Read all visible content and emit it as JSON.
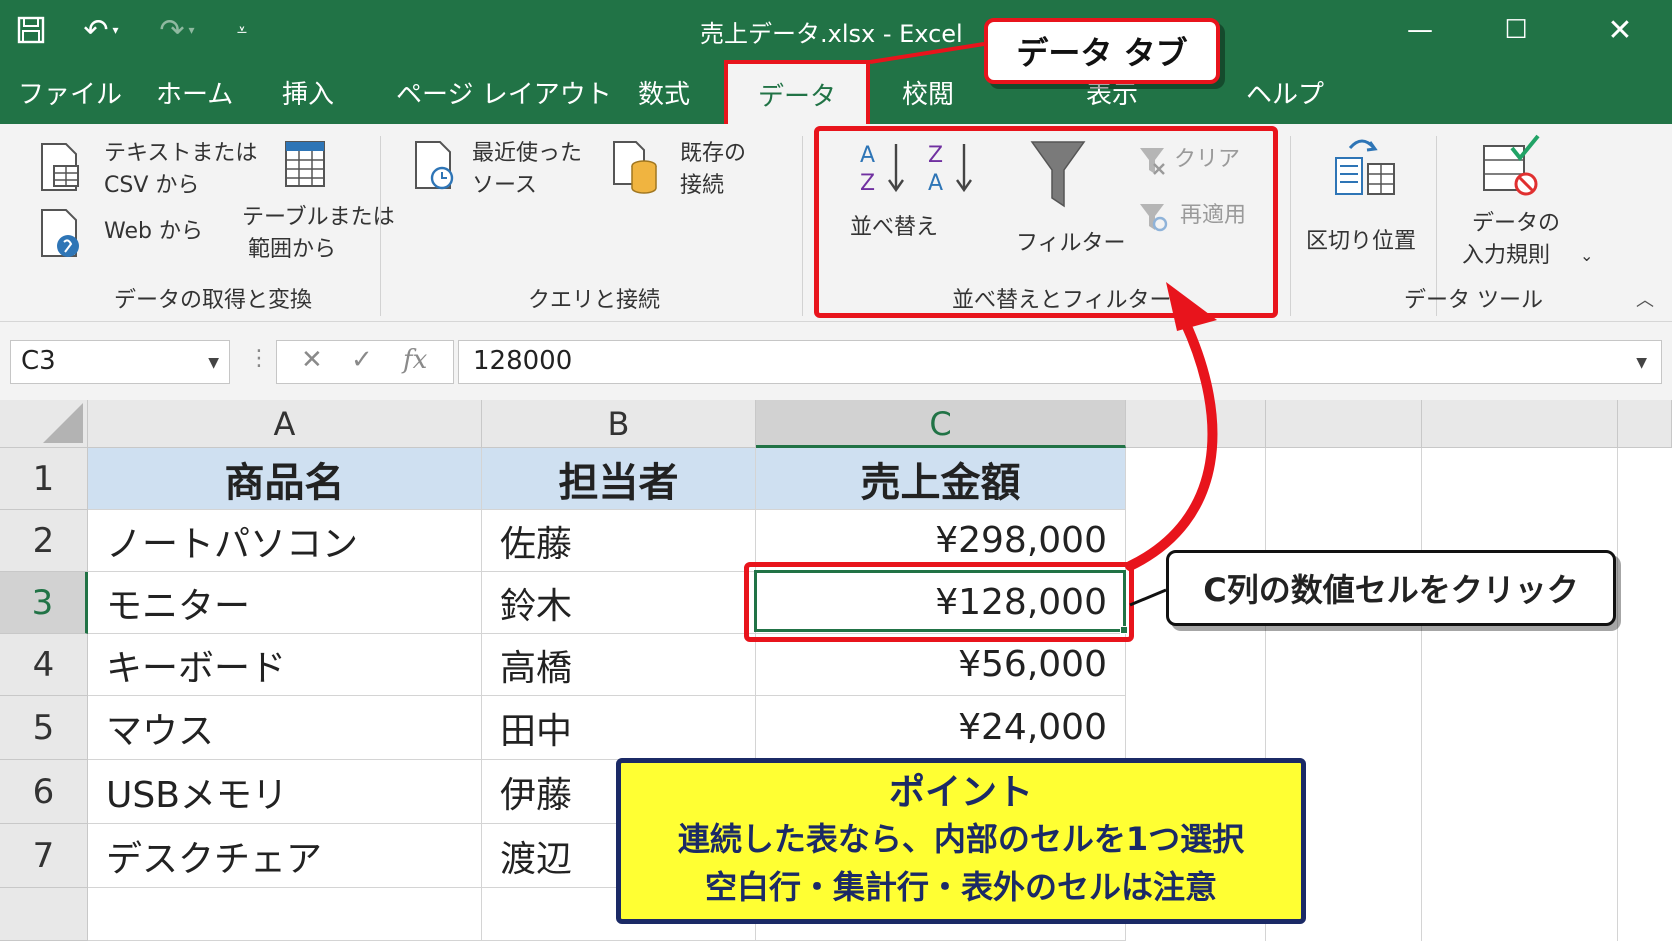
{
  "window": {
    "title": "売上データ.xlsx  -  Excel"
  },
  "tabs": [
    "ファイル",
    "ホーム",
    "挿入",
    "ページ レイアウト",
    "数式",
    "データ",
    "校閲",
    "表示",
    "ヘルプ"
  ],
  "ribbon": {
    "groups": {
      "get_transform": {
        "label": "データの取得と変換",
        "text_csv_line1": "テキストまたは",
        "text_csv_line2": "CSV から",
        "web": "Web から",
        "table_range_line1": "テーブルまたは",
        "table_range_line2": "範囲から"
      },
      "queries": {
        "label": "クエリと接続",
        "recent_line1": "最近使った",
        "recent_line2": "ソース",
        "existing_line1": "既存の",
        "existing_line2": "接続"
      },
      "sort_filter": {
        "label": "並べ替えとフィルター",
        "sort": "並べ替え",
        "filter": "フィルター",
        "clear": "クリア",
        "reapply": "再適用"
      },
      "data_tools": {
        "label": "データ ツール",
        "text_to_columns": "区切り位置",
        "validation_line1": "データの",
        "validation_line2": "入力規則"
      }
    }
  },
  "formula_bar": {
    "name_box": "C3",
    "value": "128000"
  },
  "grid": {
    "columns": [
      "A",
      "B",
      "C"
    ],
    "rows": [
      "1",
      "2",
      "3",
      "4",
      "5",
      "6",
      "7"
    ],
    "header": [
      "商品名",
      "担当者",
      "売上金額"
    ],
    "data": [
      [
        "ノートパソコン",
        "佐藤",
        "¥298,000"
      ],
      [
        "モニター",
        "鈴木",
        "¥128,000"
      ],
      [
        "キーボード",
        "高橋",
        "¥56,000"
      ],
      [
        "マウス",
        "田中",
        "¥24,000"
      ],
      [
        "USBメモリ",
        "伊藤",
        ""
      ],
      [
        "デスクチェア",
        "渡辺",
        ""
      ]
    ],
    "active_cell": "C3"
  },
  "annotations": {
    "tab_callout": "データ タブ",
    "cell_callout": "C列の数値セルをクリック",
    "point_title": "ポイント",
    "point_line1": "連続した表なら、内部のセルを1つ選択",
    "point_line2": "空白行・集計行・表外のセルは注意"
  },
  "colors": {
    "excel_green": "#217346",
    "highlight_red": "#e8141c",
    "header_fill": "#cfe0f1",
    "point_fill": "#ffff33",
    "point_border": "#1b2a66"
  }
}
